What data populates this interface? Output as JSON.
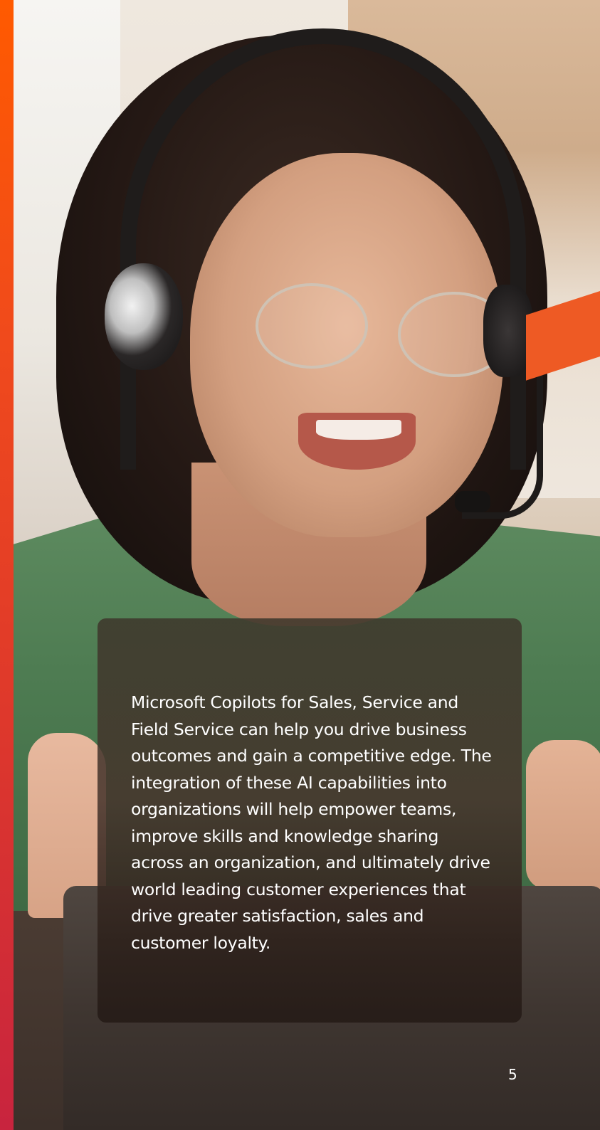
{
  "body": {
    "paragraph": "Microsoft Copilots for Sales, Service and Field Service can help you drive business outcomes and gain a competitive edge. The integration of these AI capabilities into organizations will help empower teams, improve skills and knowledge sharing across an organization, and ultimately drive world leading customer experiences that drive greater satisfaction, sales and customer loyalty."
  },
  "page": {
    "number": "5"
  },
  "colors": {
    "accent_bar_top": "#ff5a00",
    "accent_bar_bottom": "#c8243e",
    "accent_slash": "#ee5a24",
    "text": "#ffffff"
  },
  "images": {
    "hero_photo": "woman-with-headset-photo"
  }
}
